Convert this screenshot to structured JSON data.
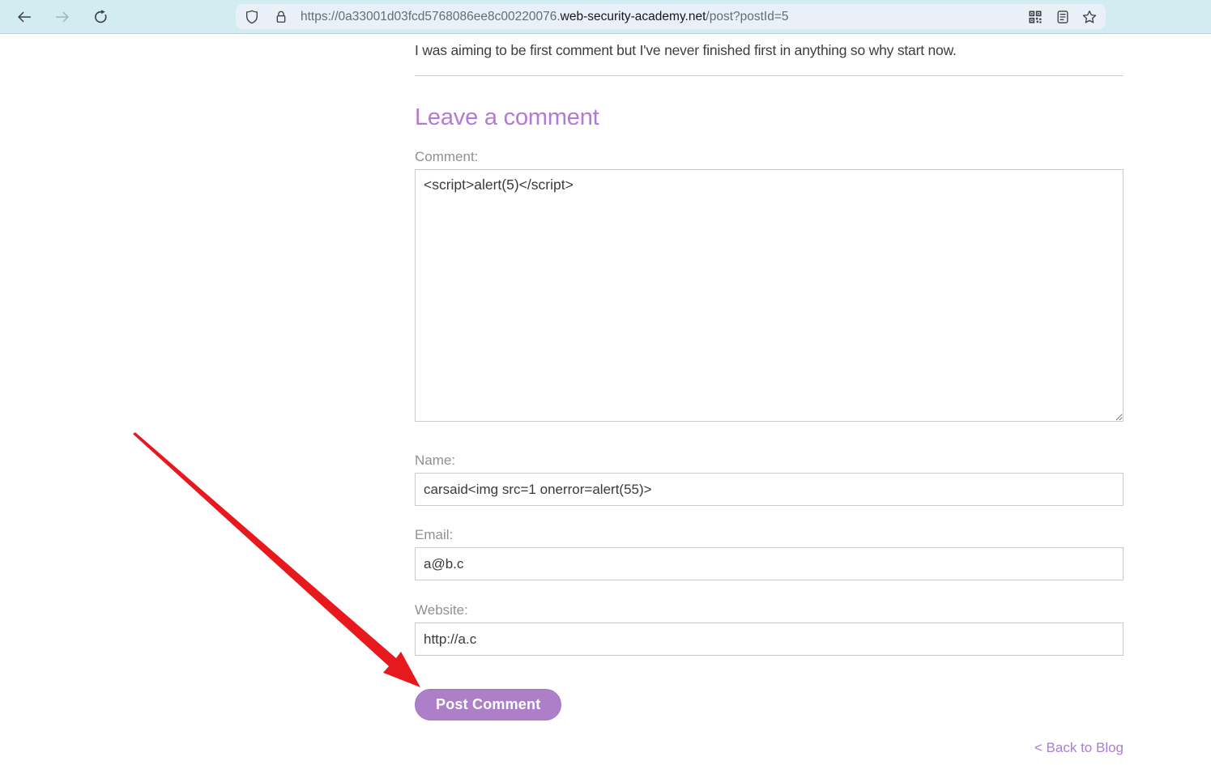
{
  "browser": {
    "url_scheme_subdomain": "https://0a33001d03fcd5768086ee8c00220076.",
    "url_domain": "web-security-academy.net",
    "url_path": "/post?postId=5"
  },
  "content": {
    "existing_comment": "I was aiming to be first comment but I've never finished first in anything so why start now.",
    "heading": "Leave a comment",
    "form": {
      "comment_label": "Comment:",
      "comment_value": "<script>alert(5)</script>",
      "name_label": "Name:",
      "name_value": "carsaid<img src=1 onerror=alert(55)>",
      "email_label": "Email:",
      "email_value": "a@b.c",
      "website_label": "Website:",
      "website_value": "http://a.c",
      "submit_label": "Post Comment"
    },
    "back_link_label": "< Back to Blog"
  },
  "colors": {
    "chrome_bg": "#d2ecf1",
    "urlbar_bg": "#eaf0f7",
    "accent_purple": "#b379d4",
    "button_purple": "#ad7fc9",
    "label_gray": "#909090",
    "arrow_red": "#e7191f"
  }
}
